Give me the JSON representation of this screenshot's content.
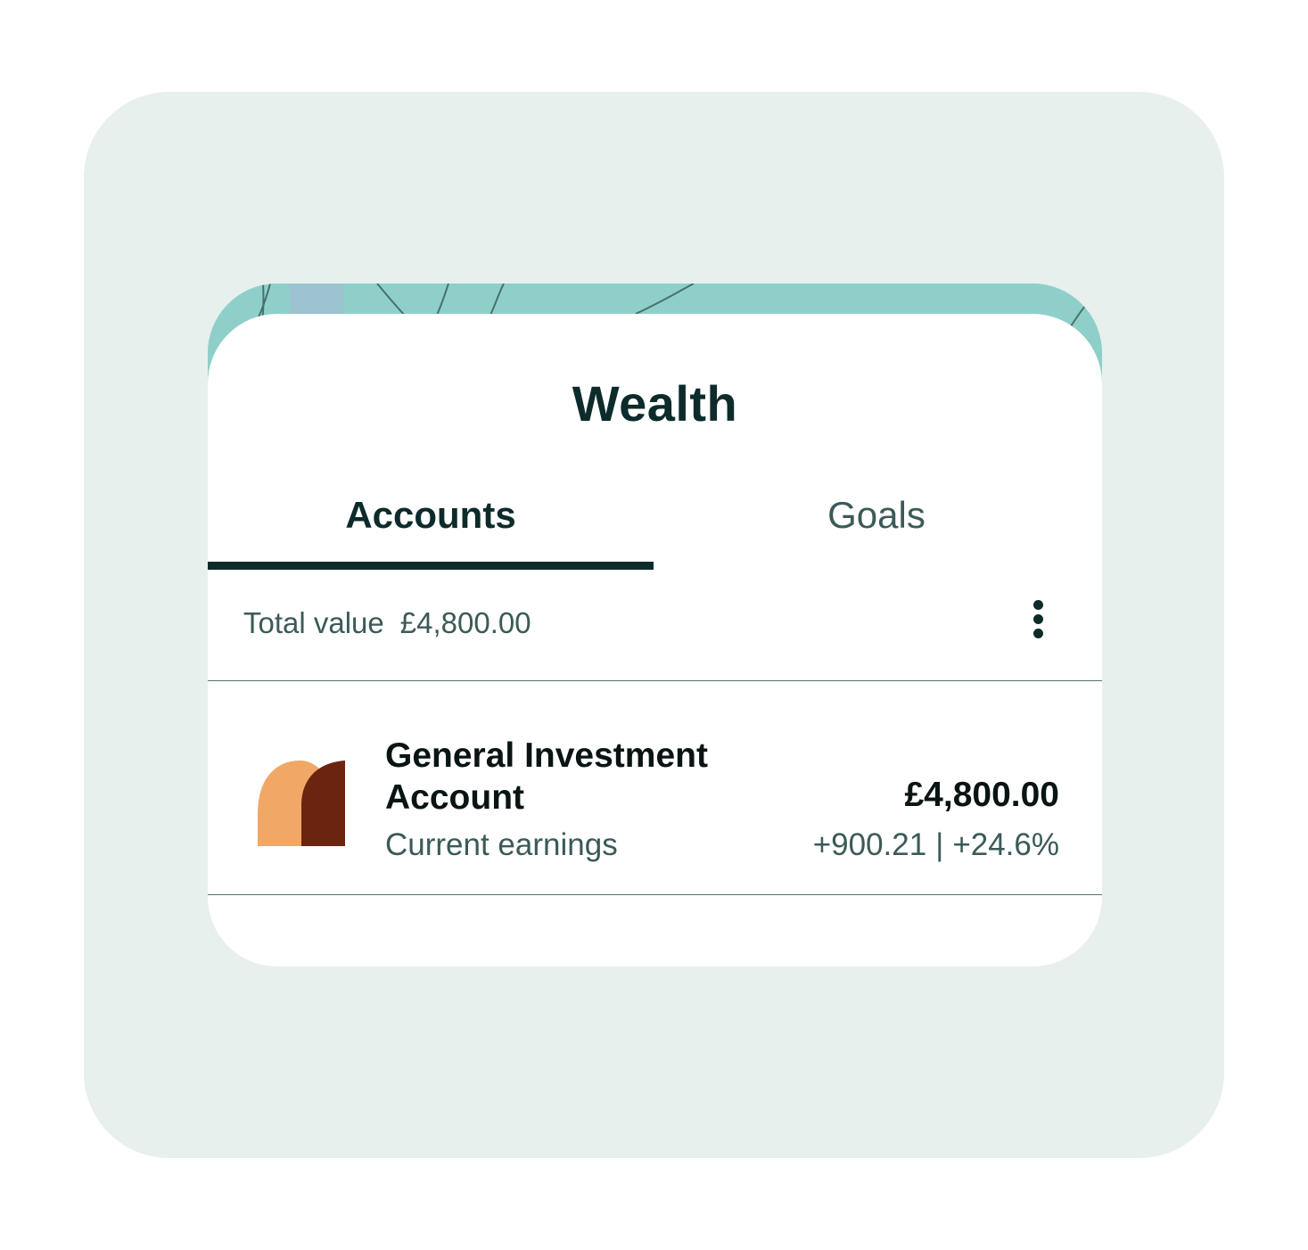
{
  "header": {
    "title": "Wealth"
  },
  "tabs": [
    {
      "label": "Accounts",
      "active": true
    },
    {
      "label": "Goals",
      "active": false
    }
  ],
  "summary": {
    "total_label": "Total value",
    "total_value": "£4,800.00",
    "more_icon": "more-vertical-icon"
  },
  "accounts": [
    {
      "name": "General Investment Account",
      "value": "£4,800.00",
      "earnings_label": "Current earnings",
      "earnings_amount": "+900.21",
      "earnings_separator": "|",
      "earnings_percent": "+24.6%",
      "logo_icon": "investment-account-logo-icon",
      "logo_colors": [
        "#f1a866",
        "#6b2410"
      ]
    }
  ],
  "colors": {
    "backdrop": "#e7f0ed",
    "hero": "#8fcfca",
    "text_primary": "#0d2b2b",
    "text_secondary": "#3b5a58"
  }
}
